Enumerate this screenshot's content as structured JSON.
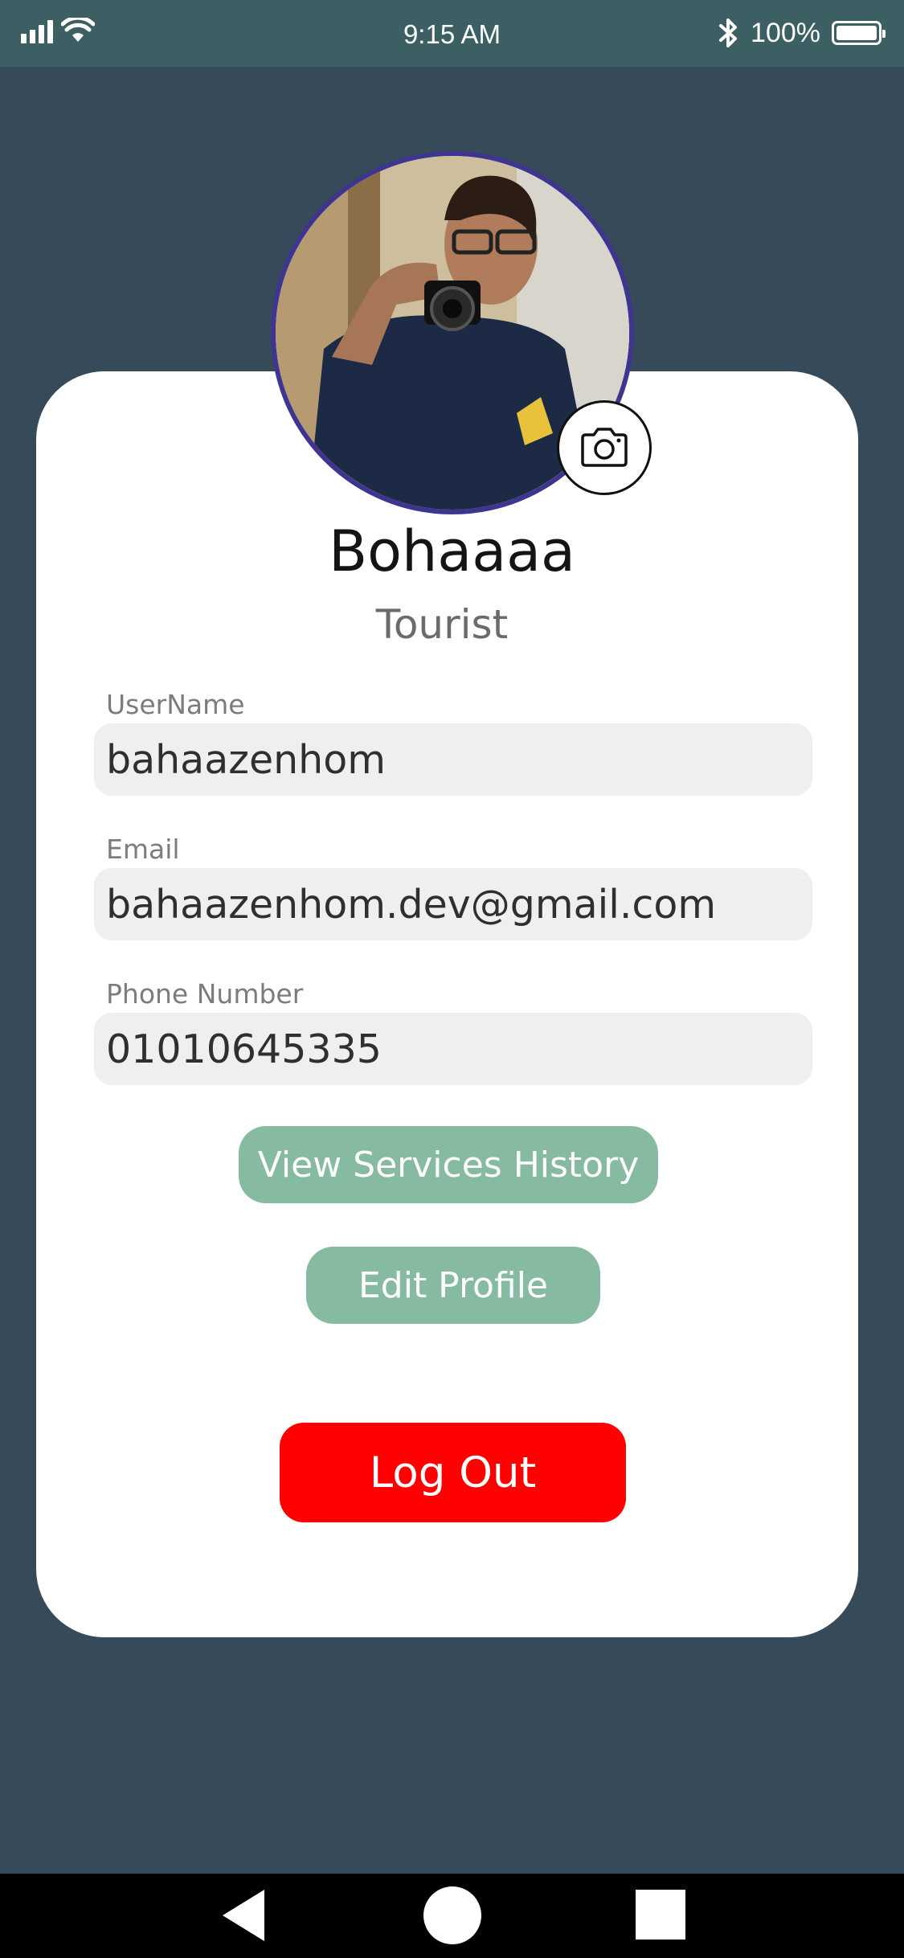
{
  "status_bar": {
    "time": "9:15 AM",
    "battery_percent": "100%",
    "battery_level": 1.0,
    "icons": [
      "signal-icon",
      "wifi-icon",
      "bluetooth-icon",
      "battery-icon"
    ]
  },
  "profile": {
    "name": "Bohaaaa",
    "role": "Tourist",
    "avatar_icon": "profile-photo",
    "camera_icon": "camera-icon"
  },
  "fields": {
    "username": {
      "label": "UserName",
      "value": "bahaazenhom"
    },
    "email": {
      "label": "Email",
      "value": "bahaazenhom.dev@gmail.com"
    },
    "phone": {
      "label": "Phone Number",
      "value": "01010645335"
    }
  },
  "buttons": {
    "view_history": "View Services History",
    "edit_profile": "Edit Profile",
    "logout": "Log Out"
  },
  "colors": {
    "background": "#374a5a",
    "status_bar": "#3b5f62",
    "avatar_ring": "#3d3590",
    "button_green": "#86bba2",
    "button_logout": "#ff0000"
  },
  "nav_bar": {
    "icons": [
      "back-icon",
      "home-icon",
      "recents-icon"
    ]
  }
}
